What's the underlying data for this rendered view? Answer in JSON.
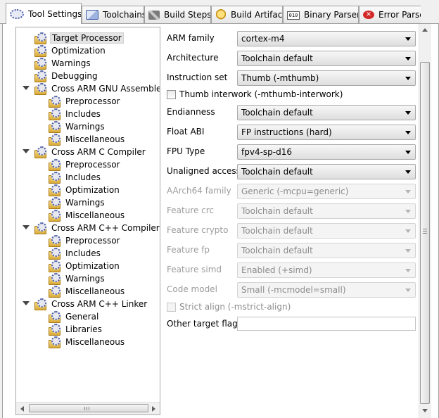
{
  "tabs": [
    {
      "label": "Tool Settings",
      "icon": "gear-icon",
      "active": true
    },
    {
      "label": "Toolchains",
      "icon": "toolchain-icon",
      "active": false
    },
    {
      "label": "Build Steps",
      "icon": "build-steps-icon",
      "active": false
    },
    {
      "label": "Build Artifact",
      "icon": "build-artifact-icon",
      "active": false
    },
    {
      "label": "Binary Parsers",
      "icon": "binary-parser-icon",
      "active": false
    },
    {
      "label": "Error Parse",
      "icon": "error-icon",
      "active": false
    }
  ],
  "tree": [
    {
      "label": "Target Processor",
      "selected": true
    },
    {
      "label": "Optimization"
    },
    {
      "label": "Warnings"
    },
    {
      "label": "Debugging"
    },
    {
      "label": "Cross ARM GNU Assembler",
      "expanded": true,
      "children": [
        "Preprocessor",
        "Includes",
        "Warnings",
        "Miscellaneous"
      ]
    },
    {
      "label": "Cross ARM C Compiler",
      "expanded": true,
      "children": [
        "Preprocessor",
        "Includes",
        "Optimization",
        "Warnings",
        "Miscellaneous"
      ]
    },
    {
      "label": "Cross ARM C++ Compiler",
      "expanded": true,
      "children": [
        "Preprocessor",
        "Includes",
        "Optimization",
        "Warnings",
        "Miscellaneous"
      ]
    },
    {
      "label": "Cross ARM C++ Linker",
      "expanded": true,
      "children": [
        "General",
        "Libraries",
        "Miscellaneous"
      ]
    }
  ],
  "settings": {
    "arm_family": {
      "label": "ARM family",
      "value": "cortex-m4"
    },
    "architecture": {
      "label": "Architecture",
      "value": "Toolchain default"
    },
    "instruction_set": {
      "label": "Instruction set",
      "value": "Thumb (-mthumb)"
    },
    "thumb_interwork": {
      "label": "Thumb interwork (-mthumb-interwork)",
      "checked": false
    },
    "endianness": {
      "label": "Endianness",
      "value": "Toolchain default"
    },
    "float_abi": {
      "label": "Float ABI",
      "value": "FP instructions (hard)"
    },
    "fpu_type": {
      "label": "FPU Type",
      "value": "fpv4-sp-d16"
    },
    "unaligned_access": {
      "label": "Unaligned access",
      "value": "Toolchain default"
    },
    "aarch64_family": {
      "label": "AArch64 family",
      "value": "Generic (-mcpu=generic)",
      "disabled": true
    },
    "feature_crc": {
      "label": "Feature crc",
      "value": "Toolchain default",
      "disabled": true
    },
    "feature_crypto": {
      "label": "Feature crypto",
      "value": "Toolchain default",
      "disabled": true
    },
    "feature_fp": {
      "label": "Feature fp",
      "value": "Toolchain default",
      "disabled": true
    },
    "feature_simd": {
      "label": "Feature simd",
      "value": "Enabled (+simd)",
      "disabled": true
    },
    "code_model": {
      "label": "Code model",
      "value": "Small (-mcmodel=small)",
      "disabled": true
    },
    "strict_align": {
      "label": "Strict align (-mstrict-align)",
      "checked": false,
      "disabled": true
    },
    "other_target_flags": {
      "label": "Other target flags",
      "value": ""
    }
  }
}
